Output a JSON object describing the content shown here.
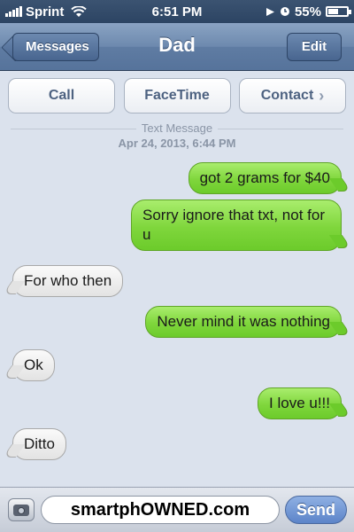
{
  "status_bar": {
    "carrier": "Sprint",
    "time": "6:51 PM",
    "battery_percent": "55%",
    "battery_level": 0.55
  },
  "nav": {
    "back_label": "Messages",
    "title": "Dad",
    "edit_label": "Edit"
  },
  "actions": [
    {
      "label": "Call"
    },
    {
      "label": "FaceTime"
    },
    {
      "label": "Contact"
    }
  ],
  "meta": {
    "type": "Text Message",
    "timestamp": "Apr 24, 2013, 6:44 PM"
  },
  "messages": [
    {
      "direction": "sent",
      "text": "got 2 grams for $40"
    },
    {
      "direction": "sent",
      "text": "Sorry ignore that txt, not for u"
    },
    {
      "direction": "received",
      "text": "For who then"
    },
    {
      "direction": "sent",
      "text": "Never mind it was nothing"
    },
    {
      "direction": "received",
      "text": "Ok"
    },
    {
      "direction": "sent",
      "text": "I love u!!!"
    },
    {
      "direction": "received",
      "text": "Ditto"
    }
  ],
  "composer": {
    "input_value": "smartphOWNED.com",
    "send_label": "Send"
  },
  "colors": {
    "sent_bubble": "#7fd63c",
    "received_bubble": "#e8e8e8",
    "nav_bar": "#6d89ae",
    "background": "#dbe2ed"
  },
  "icons": {
    "back": "chevron-left-icon",
    "contact": "chevron-right-icon",
    "camera": "camera-icon",
    "wifi": "wifi-icon",
    "location": "location-arrow-icon",
    "alarm": "alarm-icon",
    "battery": "battery-icon",
    "signal": "signal-bars-icon"
  }
}
